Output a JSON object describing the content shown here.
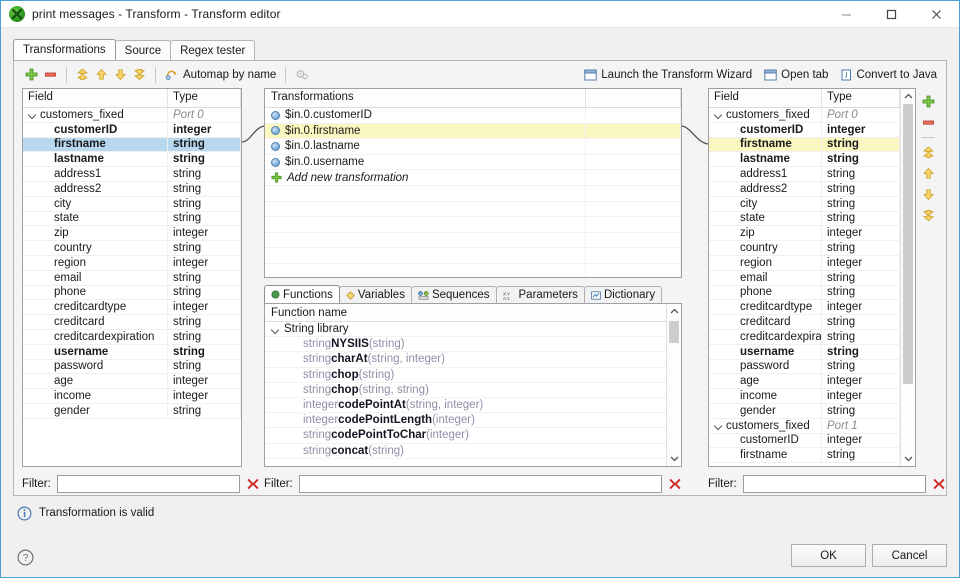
{
  "window": {
    "title": "print messages - Transform - Transform editor",
    "app_icon": "clover-green-icon",
    "minimize": "minimize-icon",
    "maximize": "maximize-icon",
    "close": "close-icon"
  },
  "tabs": [
    {
      "label": "Transformations",
      "active": true
    },
    {
      "label": "Source",
      "active": false
    },
    {
      "label": "Regex tester",
      "active": false
    }
  ],
  "toolbar": {
    "add": "plus-icon",
    "remove": "minus-icon",
    "move_top": "move-to-top-icon",
    "move_up": "move-up-icon",
    "move_down": "move-down-icon",
    "move_bottom": "move-to-bottom-icon",
    "automap_icon": "automap-icon",
    "automap_label": "Automap by name",
    "settings_icon": "gear-icon",
    "wizard_icon": "window-icon",
    "wizard_label": "Launch the Transform Wizard",
    "open_tab_icon": "window-icon",
    "open_tab_label": "Open tab",
    "convert_icon": "java-icon",
    "convert_label": "Convert to Java"
  },
  "input_panel": {
    "headers": {
      "field": "Field",
      "type": "Type"
    },
    "rows": [
      {
        "name": "customers_fixed",
        "type": "Port 0",
        "group": true,
        "bold": false,
        "selected": ""
      },
      {
        "name": "customerID",
        "type": "integer",
        "group": false,
        "bold": true,
        "selected": ""
      },
      {
        "name": "firstname",
        "type": "string",
        "group": false,
        "bold": true,
        "selected": "blue"
      },
      {
        "name": "lastname",
        "type": "string",
        "group": false,
        "bold": true,
        "selected": ""
      },
      {
        "name": "address1",
        "type": "string",
        "group": false,
        "bold": false,
        "selected": ""
      },
      {
        "name": "address2",
        "type": "string",
        "group": false,
        "bold": false,
        "selected": ""
      },
      {
        "name": "city",
        "type": "string",
        "group": false,
        "bold": false,
        "selected": ""
      },
      {
        "name": "state",
        "type": "string",
        "group": false,
        "bold": false,
        "selected": ""
      },
      {
        "name": "zip",
        "type": "integer",
        "group": false,
        "bold": false,
        "selected": ""
      },
      {
        "name": "country",
        "type": "string",
        "group": false,
        "bold": false,
        "selected": ""
      },
      {
        "name": "region",
        "type": "integer",
        "group": false,
        "bold": false,
        "selected": ""
      },
      {
        "name": "email",
        "type": "string",
        "group": false,
        "bold": false,
        "selected": ""
      },
      {
        "name": "phone",
        "type": "string",
        "group": false,
        "bold": false,
        "selected": ""
      },
      {
        "name": "creditcardtype",
        "type": "integer",
        "group": false,
        "bold": false,
        "selected": ""
      },
      {
        "name": "creditcard",
        "type": "string",
        "group": false,
        "bold": false,
        "selected": ""
      },
      {
        "name": "creditcardexpiration",
        "type": "string",
        "group": false,
        "bold": false,
        "selected": ""
      },
      {
        "name": "username",
        "type": "string",
        "group": false,
        "bold": true,
        "selected": ""
      },
      {
        "name": "password",
        "type": "string",
        "group": false,
        "bold": false,
        "selected": ""
      },
      {
        "name": "age",
        "type": "integer",
        "group": false,
        "bold": false,
        "selected": ""
      },
      {
        "name": "income",
        "type": "integer",
        "group": false,
        "bold": false,
        "selected": ""
      },
      {
        "name": "gender",
        "type": "string",
        "group": false,
        "bold": false,
        "selected": ""
      }
    ],
    "filter_label": "Filter:",
    "filter_value": "",
    "clear_icon": "clear-x-icon"
  },
  "transform_panel": {
    "header": "Transformations",
    "rows": [
      {
        "label": "$in.0.customerID",
        "selected": false
      },
      {
        "label": "$in.0.firstname",
        "selected": true
      },
      {
        "label": "$in.0.lastname",
        "selected": false
      },
      {
        "label": "$in.0.username",
        "selected": false
      }
    ],
    "add_label": "Add new transformation",
    "add_icon": "plus-icon"
  },
  "library_panel": {
    "tabs": [
      {
        "label": "Functions",
        "icon": "function-icon",
        "active": true
      },
      {
        "label": "Variables",
        "icon": "variable-icon",
        "active": false
      },
      {
        "label": "Sequences",
        "icon": "sequence-icon",
        "active": false
      },
      {
        "label": "Parameters",
        "icon": "parameter-icon",
        "active": false
      },
      {
        "label": "Dictionary",
        "icon": "dictionary-icon",
        "active": false
      }
    ],
    "header": "Function name",
    "library_name": "String library",
    "functions": [
      {
        "ret": "string",
        "name": "NYSIIS",
        "args": "(string)"
      },
      {
        "ret": "string",
        "name": "charAt",
        "args": "(string, integer)"
      },
      {
        "ret": "string",
        "name": "chop",
        "args": "(string)"
      },
      {
        "ret": "string",
        "name": "chop",
        "args": "(string, string)"
      },
      {
        "ret": "integer",
        "name": "codePointAt",
        "args": "(string, integer)"
      },
      {
        "ret": "integer",
        "name": "codePointLength",
        "args": "(integer)"
      },
      {
        "ret": "string",
        "name": "codePointToChar",
        "args": "(integer)"
      },
      {
        "ret": "string",
        "name": "concat",
        "args": "(string)"
      }
    ],
    "filter_label": "Filter:",
    "filter_value": "",
    "clear_icon": "clear-x-icon"
  },
  "output_panel": {
    "headers": {
      "field": "Field",
      "type": "Type"
    },
    "rows": [
      {
        "name": "customers_fixed",
        "type": "Port 0",
        "group": true,
        "bold": false,
        "selected": ""
      },
      {
        "name": "customerID",
        "type": "integer",
        "group": false,
        "bold": true,
        "selected": ""
      },
      {
        "name": "firstname",
        "type": "string",
        "group": false,
        "bold": true,
        "selected": "yellow"
      },
      {
        "name": "lastname",
        "type": "string",
        "group": false,
        "bold": true,
        "selected": ""
      },
      {
        "name": "address1",
        "type": "string",
        "group": false,
        "bold": false,
        "selected": ""
      },
      {
        "name": "address2",
        "type": "string",
        "group": false,
        "bold": false,
        "selected": ""
      },
      {
        "name": "city",
        "type": "string",
        "group": false,
        "bold": false,
        "selected": ""
      },
      {
        "name": "state",
        "type": "string",
        "group": false,
        "bold": false,
        "selected": ""
      },
      {
        "name": "zip",
        "type": "integer",
        "group": false,
        "bold": false,
        "selected": ""
      },
      {
        "name": "country",
        "type": "string",
        "group": false,
        "bold": false,
        "selected": ""
      },
      {
        "name": "region",
        "type": "integer",
        "group": false,
        "bold": false,
        "selected": ""
      },
      {
        "name": "email",
        "type": "string",
        "group": false,
        "bold": false,
        "selected": ""
      },
      {
        "name": "phone",
        "type": "string",
        "group": false,
        "bold": false,
        "selected": ""
      },
      {
        "name": "creditcardtype",
        "type": "integer",
        "group": false,
        "bold": false,
        "selected": ""
      },
      {
        "name": "creditcard",
        "type": "string",
        "group": false,
        "bold": false,
        "selected": ""
      },
      {
        "name": "creditcardexpiratio",
        "type": "string",
        "group": false,
        "bold": false,
        "selected": ""
      },
      {
        "name": "username",
        "type": "string",
        "group": false,
        "bold": true,
        "selected": ""
      },
      {
        "name": "password",
        "type": "string",
        "group": false,
        "bold": false,
        "selected": ""
      },
      {
        "name": "age",
        "type": "integer",
        "group": false,
        "bold": false,
        "selected": ""
      },
      {
        "name": "income",
        "type": "integer",
        "group": false,
        "bold": false,
        "selected": ""
      },
      {
        "name": "gender",
        "type": "string",
        "group": false,
        "bold": false,
        "selected": ""
      },
      {
        "name": "customers_fixed",
        "type": "Port 1",
        "group": true,
        "bold": false,
        "selected": ""
      },
      {
        "name": "customerID",
        "type": "integer",
        "group": false,
        "bold": false,
        "selected": ""
      },
      {
        "name": "firstname",
        "type": "string",
        "group": false,
        "bold": false,
        "selected": ""
      }
    ],
    "filter_label": "Filter:",
    "filter_value": "",
    "clear_icon": "clear-x-icon"
  },
  "status": {
    "icon": "info-icon",
    "message": "Transformation is valid"
  },
  "footer": {
    "help_icon": "help-icon",
    "ok_label": "OK",
    "cancel_label": "Cancel"
  },
  "colors": {
    "accent": "#4a9fd5",
    "selection_blue": "#b8d8f0",
    "selection_yellow": "#fbf7c0",
    "add_green": "#6ab04c",
    "remove_red": "#d94f4f",
    "arrow_orange": "#e8a833"
  }
}
